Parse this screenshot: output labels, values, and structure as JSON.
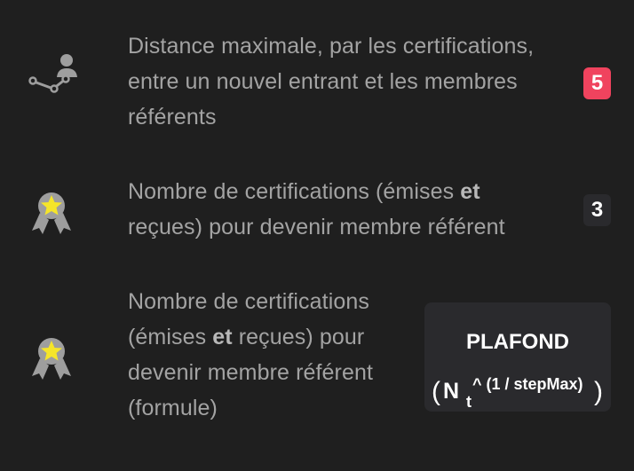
{
  "rows": [
    {
      "icon": "certification-link-icon",
      "lines": [
        "Distance maximale, par les certifications,",
        "entre un nouvel entrant et les membres",
        "référents"
      ],
      "badge": "5",
      "badge_color": "#f0435e"
    },
    {
      "icon": "referent-medal-icon",
      "lines": [
        "Nombre de certifications (émises ",
        "et",
        " reçues) pour devenir membre référent"
      ],
      "line1_pre": "Nombre de certifications (émises ",
      "line1_bold": "et",
      "line2": "reçues) pour devenir membre référent",
      "badge": "3",
      "badge_color": "#2a2a2d"
    },
    {
      "icon": "referent-medal-icon",
      "line1": "Nombre de certifications",
      "line2_pre": "(émises ",
      "line2_bold": "et",
      "line2_post": " reçues) pour",
      "line3": "devenir membre référent",
      "line4": "(formule)",
      "formula": {
        "title": "PLAFOND",
        "open_paren": "(",
        "variable": "N",
        "subscript": "t",
        "superscript": "^ (1 / stepMax)",
        "close_paren": ")"
      }
    }
  ],
  "colors": {
    "background": "#1f1f1f",
    "text": "#a3a3a3",
    "star": "#f5e52a",
    "icon": "#9e9e9e"
  }
}
